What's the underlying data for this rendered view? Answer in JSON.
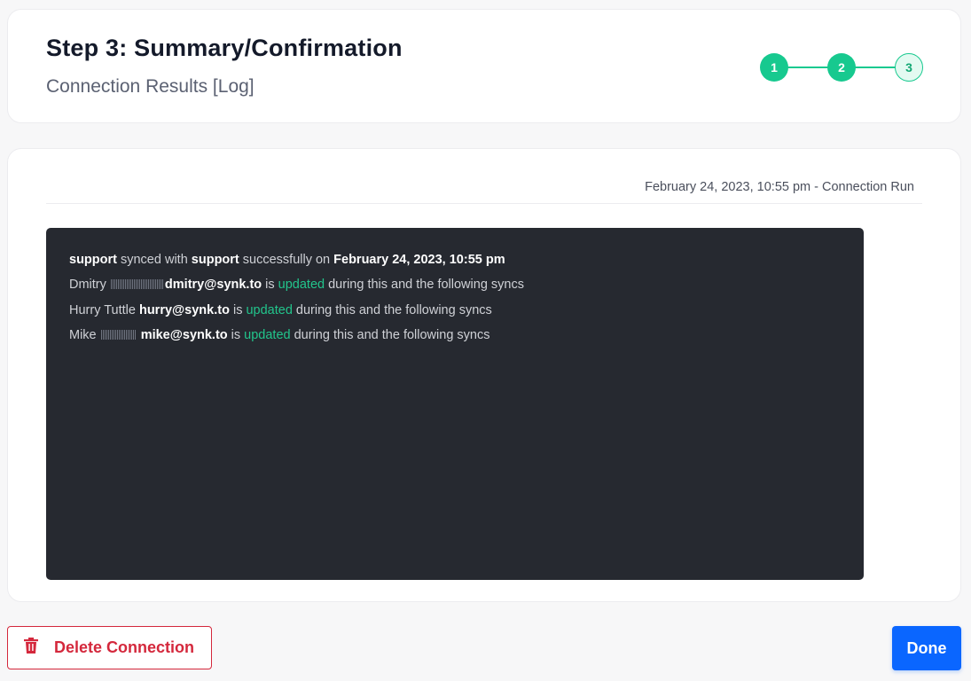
{
  "header": {
    "title": "Step 3: Summary/Confirmation",
    "subtitle": "Connection Results [Log]"
  },
  "stepper": {
    "steps": [
      {
        "label": "1",
        "state": "done"
      },
      {
        "label": "2",
        "state": "done"
      },
      {
        "label": "3",
        "state": "current"
      }
    ],
    "accent_color": "#17c98f"
  },
  "run": {
    "timestamp_label": "February 24, 2023, 10:55 pm - Connection Run"
  },
  "log": {
    "summary": {
      "source": "support",
      "text_synced_with": " synced with ",
      "target": "support",
      "text_successfully_on": " successfully on ",
      "datetime": "February 24, 2023, 10:55 pm"
    },
    "entries": [
      {
        "name": "Dmitry",
        "email": "dmitry@synk.to",
        "pre": " is ",
        "status": "updated",
        "post": " during this and the following syncs"
      },
      {
        "name": "Hurry Tuttle",
        "email": "hurry@synk.to",
        "pre": " is ",
        "status": "updated",
        "post": " during this and the following syncs"
      },
      {
        "name": "Mike",
        "email": "mike@synk.to",
        "pre": " is ",
        "status": "updated",
        "post": " during this and the following syncs"
      }
    ],
    "status_color": "#22c58c"
  },
  "actions": {
    "delete_label": "Delete Connection",
    "delete_icon": "trash-icon",
    "done_label": "Done",
    "danger_color": "#d4283c",
    "primary_color": "#0a66ff"
  }
}
